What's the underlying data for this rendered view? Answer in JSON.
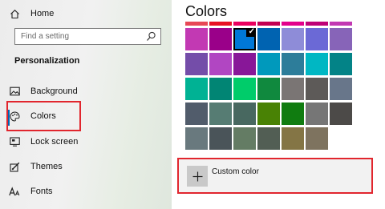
{
  "sidebar": {
    "home_label": "Home",
    "search_placeholder": "Find a setting",
    "section_title": "Personalization",
    "items": [
      {
        "label": "Background",
        "icon": "picture-icon"
      },
      {
        "label": "Colors",
        "icon": "palette-icon"
      },
      {
        "label": "Lock screen",
        "icon": "lock-screen-icon"
      },
      {
        "label": "Themes",
        "icon": "themes-icon"
      },
      {
        "label": "Fonts",
        "icon": "fonts-icon"
      }
    ],
    "selected_item": "Colors"
  },
  "main": {
    "title": "Colors",
    "top_strip_colors": [
      "#e74856",
      "#e81123",
      "#ea005e",
      "#c30052",
      "#e3008c",
      "#bf0077",
      "#c239b3"
    ],
    "swatches": [
      [
        "#c239b3",
        "#9a0089",
        "#0078d7",
        "#0063b1",
        "#8e8cd8",
        "#6b69d6",
        "#8764b8"
      ],
      [
        "#744da9",
        "#b146c2",
        "#881798",
        "#0099bc",
        "#2d7d9a",
        "#00b7c3",
        "#038387"
      ],
      [
        "#00b294",
        "#018574",
        "#00cc6a",
        "#10893e",
        "#7a7574",
        "#5d5a58",
        "#68768a"
      ],
      [
        "#515c6b",
        "#567c73",
        "#486860",
        "#498205",
        "#107c10",
        "#767676",
        "#4c4a48"
      ],
      [
        "#69797e",
        "#4a5459",
        "#647c64",
        "#525e54",
        "#847545",
        "#7e735f"
      ]
    ],
    "selected_swatch": "#0078d7",
    "custom_color_label": "Custom color"
  },
  "colors": {
    "accent": "#0063b1",
    "annotation_red": "#e1262e"
  }
}
